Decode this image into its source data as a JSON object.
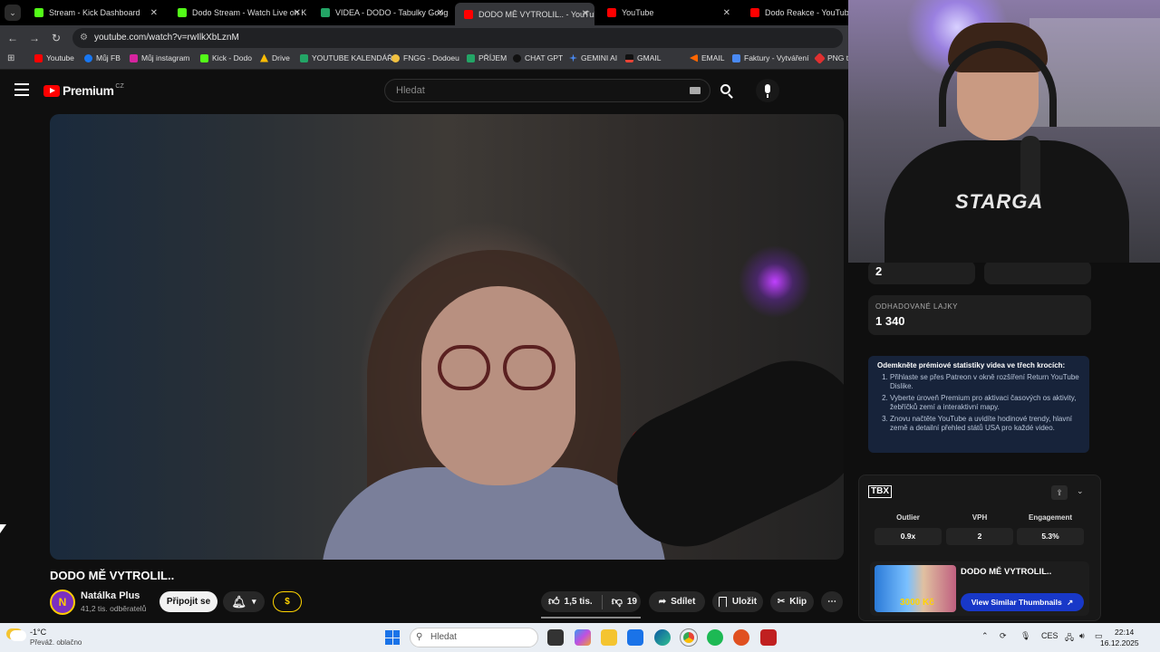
{
  "browser": {
    "tabs": [
      {
        "label": "Stream - Kick Dashboard",
        "color": "#53fc18"
      },
      {
        "label": "Dodo Stream - Watch Live on K",
        "color": "#53fc18"
      },
      {
        "label": "VIDEA - DODO - Tabulky Goog",
        "color": "#23a566"
      },
      {
        "label": "DODO MĚ VYTROLIL.. - YouTub",
        "color": "#ff0000"
      },
      {
        "label": "YouTube",
        "color": "#ff0000"
      },
      {
        "label": "Dodo Reakce - YouTube",
        "color": "#ff0000"
      }
    ],
    "url": "youtube.com/watch?v=rwIlkXbLznM",
    "bookmarks": [
      {
        "label": "Youtube",
        "color": "#ff0000"
      },
      {
        "label": "Můj FB",
        "color": "#1877f2"
      },
      {
        "label": "Můj instagram",
        "color": "#d6249f"
      },
      {
        "label": "Kick - Dodo",
        "color": "#53fc18"
      },
      {
        "label": "Drive",
        "color": "#fbbc04"
      },
      {
        "label": "YOUTUBE KALENDÁŘ",
        "color": "#23a566"
      },
      {
        "label": "FNGG - Dodoeu",
        "color": "#f0c040"
      },
      {
        "label": "PŘÍJEM",
        "color": "#23a566"
      },
      {
        "label": "CHAT GPT",
        "color": "#111111"
      },
      {
        "label": "GEMINI AI",
        "color": "#4a8af4"
      },
      {
        "label": "GMAIL",
        "color": "#ea4335"
      },
      {
        "label": "EMAIL",
        "color": "#ff6600"
      },
      {
        "label": "Faktury - Vytváření",
        "color": "#4a8af4"
      },
      {
        "label": "PNG t",
        "color": "#e03030"
      }
    ]
  },
  "youtube": {
    "logo_text": "Premium",
    "region": "CZ",
    "search_placeholder": "Hledat"
  },
  "video": {
    "title": "DODO MĚ VYTROLIL..",
    "channel": "Natálka Plus",
    "channel_initial": "N",
    "subscribers": "41,2 tis. odběratelů",
    "join_label": "Připojit se",
    "dollar_label": "$",
    "likes": "1,5 tis.",
    "dislikes": "19",
    "share_label": "Sdílet",
    "save_label": "Uložit",
    "clip_label": "Klip",
    "more_label": "⋯"
  },
  "stats": {
    "top_value": "2",
    "estimated_likes_label": "ODHADOVANÉ LAJKY",
    "estimated_likes_value": "1 340",
    "premium_heading": "Odemkněte prémiové statistiky videa ve třech krocích:",
    "premium_steps": [
      "Přihlaste se přes Patreon v okně rozšíření Return YouTube Dislike.",
      "Vyberte úroveň Premium pro aktivaci časových os aktivity, žebříčků zemí a interaktivní mapy.",
      "Znovu načtěte YouTube a uvidíte hodinové trendy, hlavní země a detailní přehled států USA pro každé video."
    ]
  },
  "extension": {
    "logo": "TBX",
    "metrics": [
      {
        "label": "Outlier",
        "value": "0.9x"
      },
      {
        "label": "VPH",
        "value": "2"
      },
      {
        "label": "Engagement",
        "value": "5.3%"
      }
    ],
    "thumb_title": "DODO MĚ VYTROLIL..",
    "thumb_price": "3000 Kč",
    "similar_button": "View Similar Thumbnails"
  },
  "webcam": {
    "shirt_text": "STARGA"
  },
  "taskbar": {
    "weather_temp": "-1°C",
    "weather_desc": "Převáž. oblačno",
    "search_placeholder": "Hledat",
    "language": "CES",
    "time": "22:14",
    "date": "16.12.2025"
  }
}
